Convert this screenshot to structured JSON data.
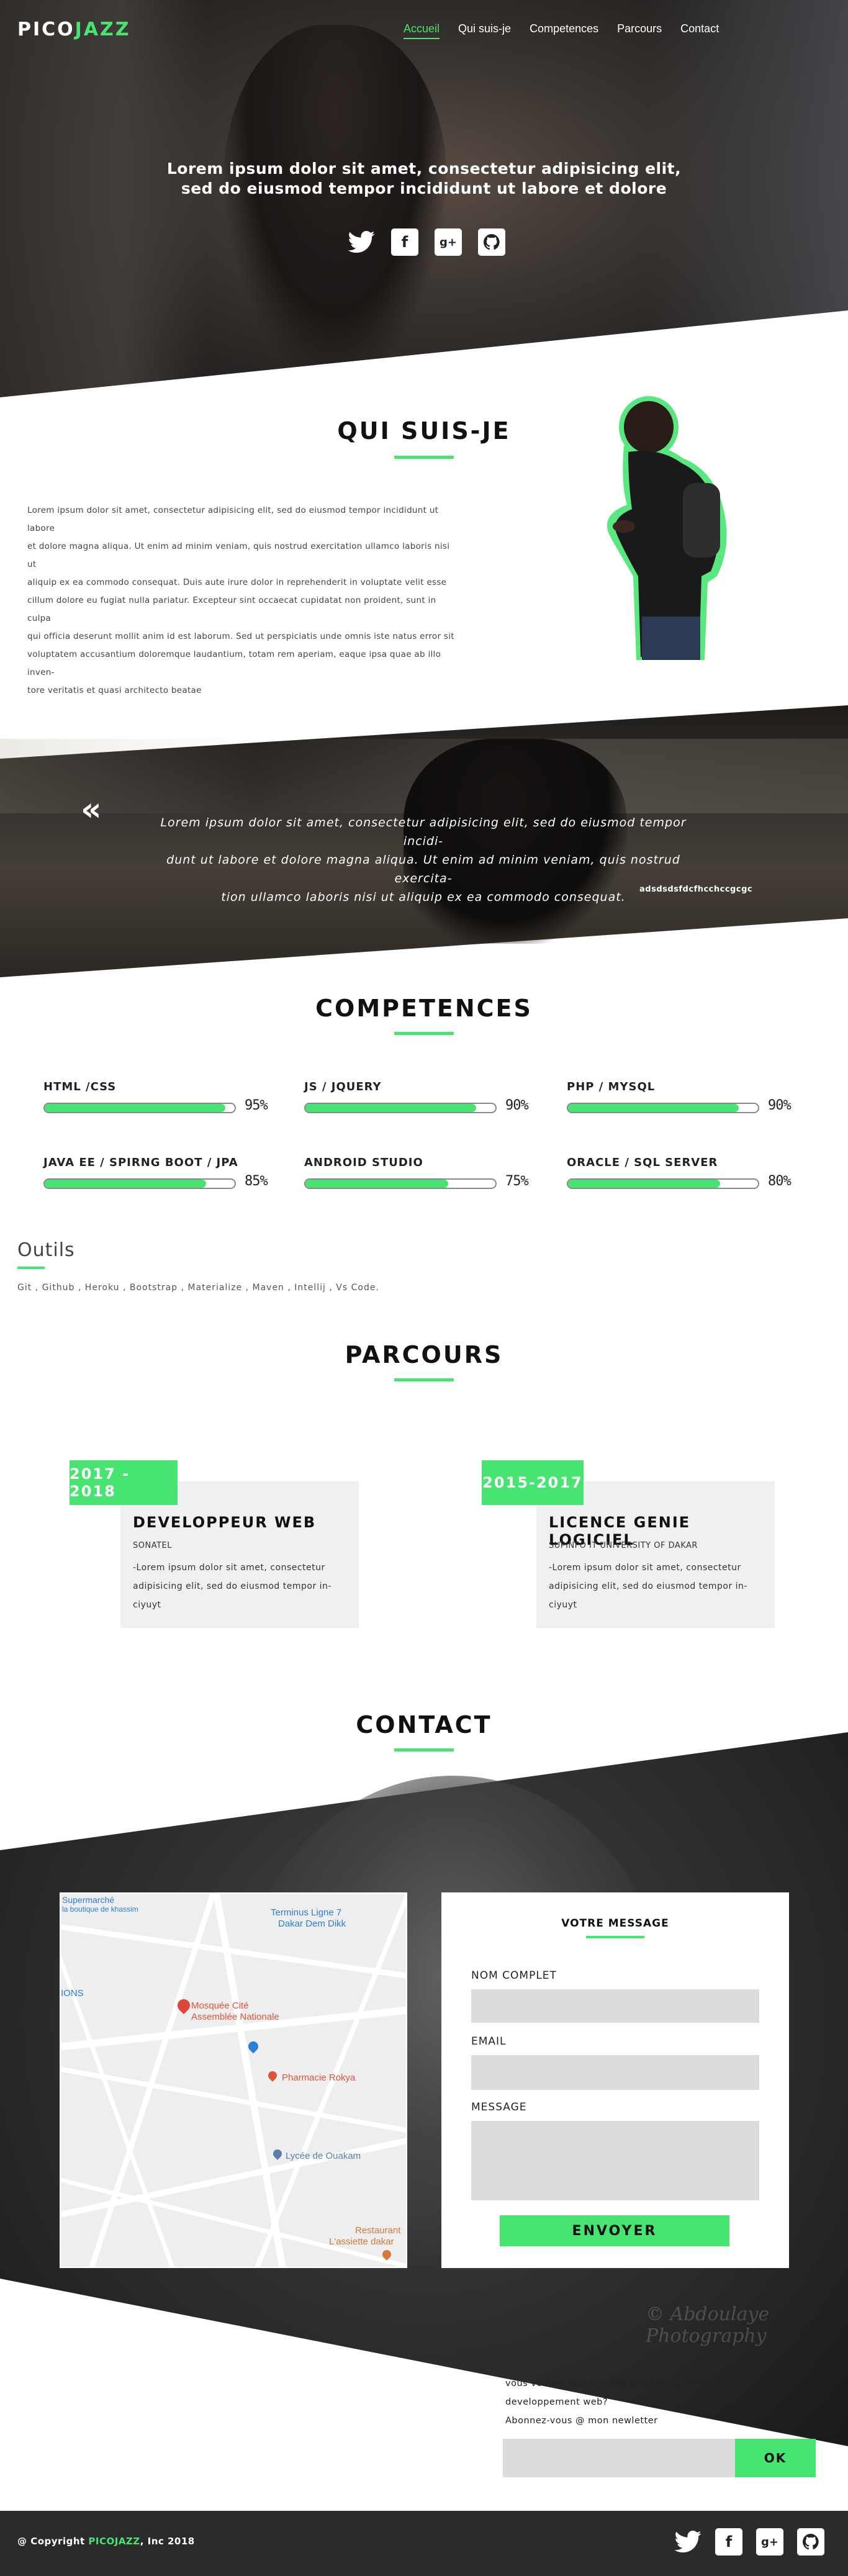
{
  "brand": {
    "part1": "PICO",
    "part2": "JAZZ",
    "accent": "#47e471"
  },
  "nav": {
    "items": [
      {
        "label": "Accueil",
        "active": true
      },
      {
        "label": "Qui suis-je"
      },
      {
        "label": "Competences"
      },
      {
        "label": "Parcours"
      },
      {
        "label": "Contact"
      }
    ]
  },
  "hero": {
    "line1": "Lorem ipsum dolor sit amet, consectetur adipisicing elit,",
    "line2": "sed do eiusmod tempor incididunt ut labore et dolore",
    "social": [
      "twitter-icon",
      "facebook-icon",
      "google-plus-icon",
      "github-icon"
    ]
  },
  "about": {
    "title": "QUI SUIS-JE",
    "lines": [
      "Lorem ipsum dolor sit amet, consectetur adipisicing elit, sed do eiusmod tempor incididunt ut labore",
      "et dolore magna aliqua. Ut enim ad minim veniam, quis nostrud exercitation ullamco laboris nisi ut",
      "aliquip ex ea commodo consequat. Duis aute irure dolor in reprehenderit in voluptate velit esse",
      "cillum dolore eu fugiat nulla pariatur. Excepteur sint occaecat cupidatat non proident, sunt in culpa",
      "qui officia deserunt mollit anim id est laborum. Sed ut perspiciatis unde omnis iste natus error sit",
      "voluptatem accusantium doloremque laudantium, totam rem aperiam, eaque ipsa quae ab illo inven-",
      "tore veritatis et quasi architecto beatae"
    ]
  },
  "quote": {
    "mark": "«",
    "line1": "Lorem ipsum dolor sit amet, consectetur adipisicing elit, sed do eiusmod tempor incidi-",
    "line2": "dunt ut labore et dolore magna aliqua. Ut enim ad minim veniam, quis nostrud exercita-",
    "line3": "tion ullamco laboris nisi ut aliquip ex ea commodo consequat.",
    "author": "adsdsdsfdcfhcchccgcgc"
  },
  "skills": {
    "title": "COMPETENCES",
    "items": [
      {
        "name": "HTML /CSS",
        "percent": 95,
        "label": "95%"
      },
      {
        "name": "JS / JQUERY",
        "percent": 90,
        "label": "90%"
      },
      {
        "name": "PHP / MYSQL",
        "percent": 90,
        "label": "90%"
      },
      {
        "name": "JAVA EE / SPIRNG BOOT / JPA",
        "percent": 85,
        "label": "85%"
      },
      {
        "name": "ANDROID STUDIO",
        "percent": 75,
        "label": "75%"
      },
      {
        "name": "ORACLE / SQL SERVER",
        "percent": 80,
        "label": "80%"
      }
    ]
  },
  "tools": {
    "title": "Outils",
    "list": "Git , Github , Heroku , Bootstrap , Materialize , Maven , Intellij , Vs Code."
  },
  "parcours": {
    "title": "PARCOURS",
    "items": [
      {
        "years": "2017 - 2018",
        "title": "DEVELOPPEUR WEB",
        "org": "SONATEL",
        "desc1": "-Lorem ipsum dolor sit amet, consectetur",
        "desc2": "adipisicing elit, sed do eiusmod tempor in-",
        "desc3": "ciyuyt"
      },
      {
        "years": "2015-2017",
        "title": "LICENCE GENIE LOGICIEL",
        "org": "SUPINFO IT UNIVERSITY OF DAKAR",
        "desc1": "-Lorem ipsum dolor sit amet, consectetur",
        "desc2": "adipisicing elit, sed do eiusmod tempor in-",
        "desc3": "ciyuyt"
      }
    ]
  },
  "contact": {
    "title": "CONTACT",
    "map": {
      "labels": {
        "supermarche1": "Supermarché",
        "supermarche2": "la boutique de khassim",
        "terminus1": "Terminus Ligne 7",
        "terminus2": "Dakar Dem Dikk",
        "ions": "IONS",
        "mosquee1": "Mosquée Cité",
        "mosquee2": "Assemblée Nationale",
        "pharmacie": "Pharmacie Rokya",
        "lycee": "Lycée de Ouakam",
        "restaurant1": "Restaurant",
        "restaurant2": "L'assiette dakar"
      }
    },
    "form": {
      "title": "VOTRE MESSAGE",
      "name_label": "NOM COMPLET",
      "email_label": "EMAIL",
      "message_label": "MESSAGE",
      "submit": "ENVOYER"
    },
    "watermark": "© Abdoulaye Photography"
  },
  "newsletter": {
    "line1": "vous voullez recevoir des articles passionnants sur le",
    "line2": "developpement web?",
    "line3": "Abonnez-vous @ mon newletter",
    "button": "OK"
  },
  "footer": {
    "copyright_prefix": "@ Copyright ",
    "copyright_brand": "PICOJAZZ",
    "copyright_suffix": ", Inc 2018"
  }
}
